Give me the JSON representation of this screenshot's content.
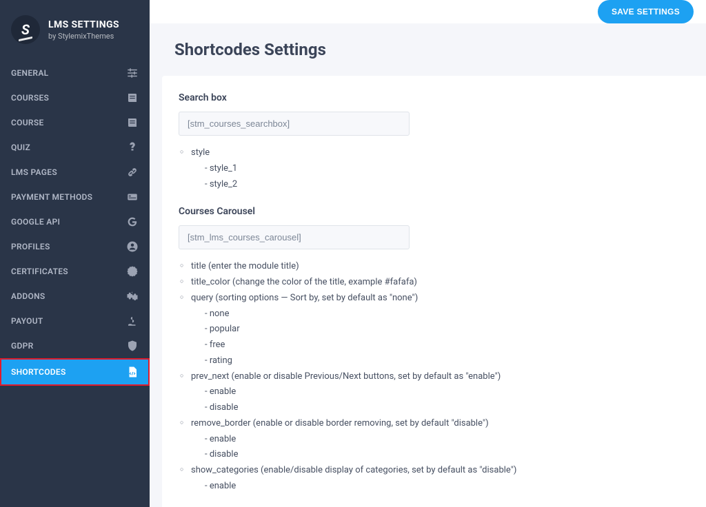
{
  "header": {
    "title": "LMS SETTINGS",
    "subtitle": "by StylemixThemes",
    "save_label": "SAVE SETTINGS"
  },
  "sidebar": {
    "items": [
      {
        "label": "GENERAL"
      },
      {
        "label": "COURSES"
      },
      {
        "label": "COURSE"
      },
      {
        "label": "QUIZ"
      },
      {
        "label": "LMS PAGES"
      },
      {
        "label": "PAYMENT METHODS"
      },
      {
        "label": "GOOGLE API"
      },
      {
        "label": "PROFILES"
      },
      {
        "label": "CERTIFICATES"
      },
      {
        "label": "ADDONS"
      },
      {
        "label": "PAYOUT"
      },
      {
        "label": "GDPR"
      },
      {
        "label": "SHORTCODES"
      }
    ]
  },
  "page": {
    "title": "Shortcodes Settings"
  },
  "sections": {
    "searchbox": {
      "title": "Search box",
      "shortcode": "[stm_courses_searchbox]",
      "params": {
        "style": {
          "label": "style",
          "opts": [
            "style_1",
            "style_2"
          ]
        }
      }
    },
    "carousel": {
      "title": "Courses Carousel",
      "shortcode": "[stm_lms_courses_carousel]",
      "params": {
        "p1": "title (enter the module title)",
        "p2": "title_color (change the color of the title, example #fafafa)",
        "p3": {
          "label": "query (sorting options — Sort by, set by default as \"none\")",
          "opts": [
            "none",
            "popular",
            "free",
            "rating"
          ]
        },
        "p4": {
          "label": "prev_next (enable or disable Previous/Next buttons, set by default as \"enable\")",
          "opts": [
            "enable",
            "disable"
          ]
        },
        "p5": {
          "label": "remove_border (enable or disable border removing, set by default \"disable\")",
          "opts": [
            "enable",
            "disable"
          ]
        },
        "p6": {
          "label": "show_categories (enable/disable display of categories, set by default as \"disable\")",
          "opts": [
            "enable"
          ]
        }
      }
    }
  }
}
